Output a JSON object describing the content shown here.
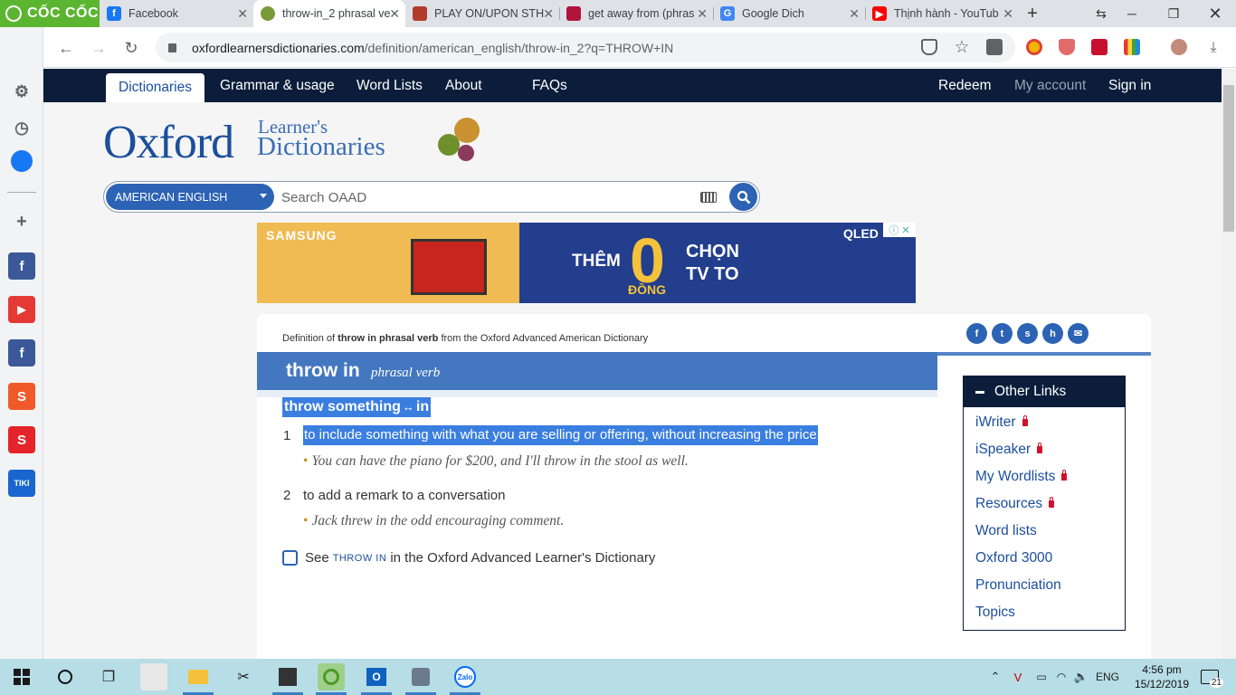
{
  "browser": {
    "brand": "CỐC CỐC",
    "tabs": [
      {
        "title": "Facebook",
        "favicon": "facebook-icon",
        "color": "#1877f2"
      },
      {
        "title": "throw-in_2 phrasal ve",
        "favicon": "oxford-icon",
        "color": "#7a9a3a",
        "active": true
      },
      {
        "title": "PLAY ON/UPON STH",
        "favicon": "cambridge-icon",
        "color": "#b23c2a"
      },
      {
        "title": "get away from (phras",
        "favicon": "book-icon",
        "color": "#b0143a"
      },
      {
        "title": "Google Dich",
        "favicon": "google-translate-icon",
        "color": "#4285f4"
      },
      {
        "title": "Thịnh hành - YouTub",
        "favicon": "youtube-icon",
        "color": "#ff0000"
      }
    ],
    "url_host": "oxfordlearnersdictionaries.com",
    "url_path": "/definition/american_english/throw-in_2?q=THROW+IN"
  },
  "nav": {
    "items": [
      "Dictionaries",
      "Grammar & usage",
      "Word Lists",
      "About",
      "FAQs"
    ],
    "right": [
      "Redeem",
      "My account",
      "Sign in"
    ]
  },
  "logo": {
    "oxford": "Oxford",
    "line1": "Learner's",
    "line2": "Dictionaries"
  },
  "search": {
    "lang": "AMERICAN ENGLISH",
    "placeholder": "Search OAAD"
  },
  "ad": {
    "brand": "SAMSUNG",
    "them": "THÊM",
    "zero": "0",
    "dong": "ĐỒNG",
    "chon1": "CHỌN",
    "chon2": "TV TO",
    "qled": "QLED"
  },
  "entry": {
    "def_of_prefix": "Definition of ",
    "def_of_bold": "throw in phrasal verb",
    "def_of_suffix": " from the Oxford Advanced American Dictionary",
    "headword": "throw in",
    "pos": "phrasal verb",
    "idiom_1": "throw something",
    "idiom_2": "in",
    "senses": [
      {
        "num": "1",
        "def": "to include something with what you are selling or offering, without increasing the price",
        "example": "You can have the piano for $200, and I'll throw in the stool as well."
      },
      {
        "num": "2",
        "def": "to add a remark to a conversation",
        "example": "Jack threw in the odd encouraging comment."
      }
    ],
    "see_prefix": "See",
    "see_link": "THROW IN",
    "see_suffix": "in the Oxford Advanced Learner's Dictionary"
  },
  "other_links": {
    "title": "Other Links",
    "items": [
      {
        "label": "iWriter",
        "locked": true
      },
      {
        "label": "iSpeaker",
        "locked": true
      },
      {
        "label": "My Wordlists",
        "locked": true
      },
      {
        "label": "Resources",
        "locked": true
      },
      {
        "label": "Word lists",
        "locked": false
      },
      {
        "label": "Oxford 3000",
        "locked": false
      },
      {
        "label": "Pronunciation",
        "locked": false
      },
      {
        "label": "Topics",
        "locked": false
      }
    ]
  },
  "taskbar": {
    "time": "4:56 pm",
    "date": "15/12/2019",
    "lang": "ENG",
    "notifications": "21"
  },
  "colors": {
    "oxford_blue": "#1b4f9c",
    "nav_dark": "#0b1d3a",
    "highlight": "#3a7ee0"
  }
}
